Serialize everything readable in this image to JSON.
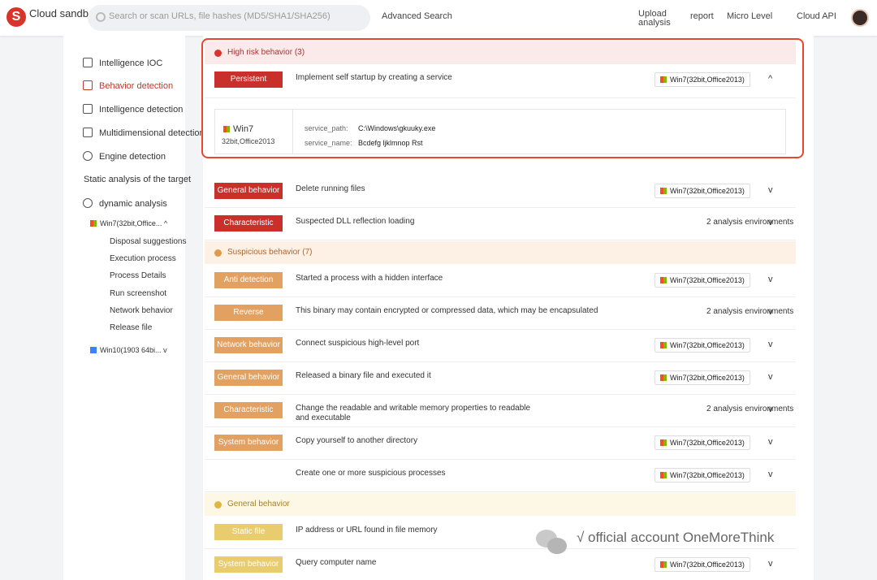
{
  "header": {
    "logo_letter": "S",
    "brand": "Cloud sandbox",
    "search_placeholder": "Search or scan URLs, file hashes (MD5/SHA1/SHA256)",
    "advanced_search": "Advanced Search",
    "nav": [
      {
        "label": "Upload analysis"
      },
      {
        "label": "report"
      },
      {
        "label": "Micro Level"
      },
      {
        "label": "Cloud API"
      }
    ]
  },
  "sidebar": {
    "items": [
      {
        "label": "Intelligence IOC"
      },
      {
        "label": "Behavior detection"
      },
      {
        "label": "Intelligence detection"
      },
      {
        "label": "Multidimensional detection"
      },
      {
        "label": "Engine detection"
      },
      {
        "label": "Static analysis of the target"
      },
      {
        "label": "dynamic analysis"
      }
    ],
    "env1": "Win7(32bit,Office...",
    "env1_children": [
      "Disposal suggestions",
      "Execution process",
      "Process Details",
      "Run screenshot",
      "Network behavior",
      "Release file"
    ],
    "env2": "Win10(1903 64bi..."
  },
  "sections": {
    "high": {
      "label": "High risk behavior (3)",
      "color": "#d9342b"
    },
    "suspicious": {
      "label": "Suspicious behavior (7)",
      "color": "#e09a4e"
    },
    "general": {
      "label": "General behavior",
      "color": "#e0b642"
    }
  },
  "rows": [
    {
      "tag": "Persistent",
      "desc": "Implement self startup by creating a service",
      "env": "Win7(32bit,Office2013)",
      "chev": "^"
    },
    {
      "tag": "General behavior",
      "desc": "Delete running files",
      "env": "Win7(32bit,Office2013)",
      "chev": "v"
    },
    {
      "tag": "Characteristic behavior",
      "desc": "Suspected DLL reflection loading",
      "count": "2 analysis environments",
      "chev": "v"
    },
    {
      "tag": "Anti detection behavior",
      "desc": "Started a process with a hidden interface",
      "env": "Win7(32bit,Office2013)",
      "chev": "v"
    },
    {
      "tag": "Reverse engineering",
      "desc": "This binary may contain encrypted or compressed data, which may be encapsulated",
      "count": "2 analysis environments",
      "chev": "v"
    },
    {
      "tag": "Network behavior",
      "desc": "Connect suspicious high-level port",
      "env": "Win7(32bit,Office2013)",
      "chev": "v"
    },
    {
      "tag": "General behavior",
      "desc": "Released a binary file and executed it",
      "env": "Win7(32bit,Office2013)",
      "chev": "v"
    },
    {
      "tag": "Characteristic behavior",
      "desc": "Change the readable and writable memory properties to readable and executable",
      "count": "2 analysis environments",
      "chev": "v"
    },
    {
      "tag": "System behavior",
      "desc": "Copy yourself to another directory",
      "env": "Win7(32bit,Office2013)",
      "chev": "v"
    },
    {
      "tag": "",
      "desc": "Create one or more suspicious processes",
      "env": "Win7(32bit,Office2013)",
      "chev": "v"
    },
    {
      "tag": "Static file",
      "desc": "IP address or URL found in file memory",
      "env": "",
      "chev": ""
    },
    {
      "tag": "System behavior",
      "desc": "Query computer name",
      "env": "Win7(32bit,Office2013)",
      "chev": "v"
    }
  ],
  "detail": {
    "os": "Win7",
    "os_version": "32bit,Office2013",
    "fields": [
      {
        "key": "service_path:",
        "value": "C:\\Windows\\gkuuky.exe"
      },
      {
        "key": "service_name:",
        "value": "Bcdefg ljklmnop Rst"
      }
    ]
  },
  "watermark": "√ official account OneMoreThink"
}
